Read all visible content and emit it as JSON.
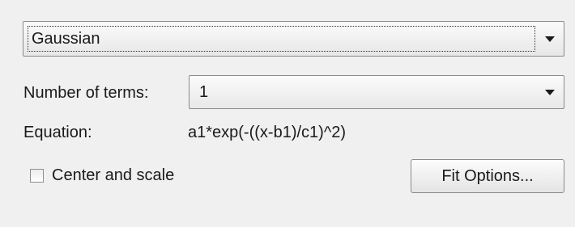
{
  "fit_type": {
    "selected": "Gaussian",
    "arrow_icon": "chevron-down-icon"
  },
  "terms": {
    "label": "Number of terms:",
    "selected": "1"
  },
  "equation": {
    "label": "Equation:",
    "value": "a1*exp(-((x-b1)/c1)^2)"
  },
  "center_and_scale": {
    "label": "Center and scale",
    "checked": false
  },
  "fit_options_button": {
    "label": "Fit Options..."
  }
}
